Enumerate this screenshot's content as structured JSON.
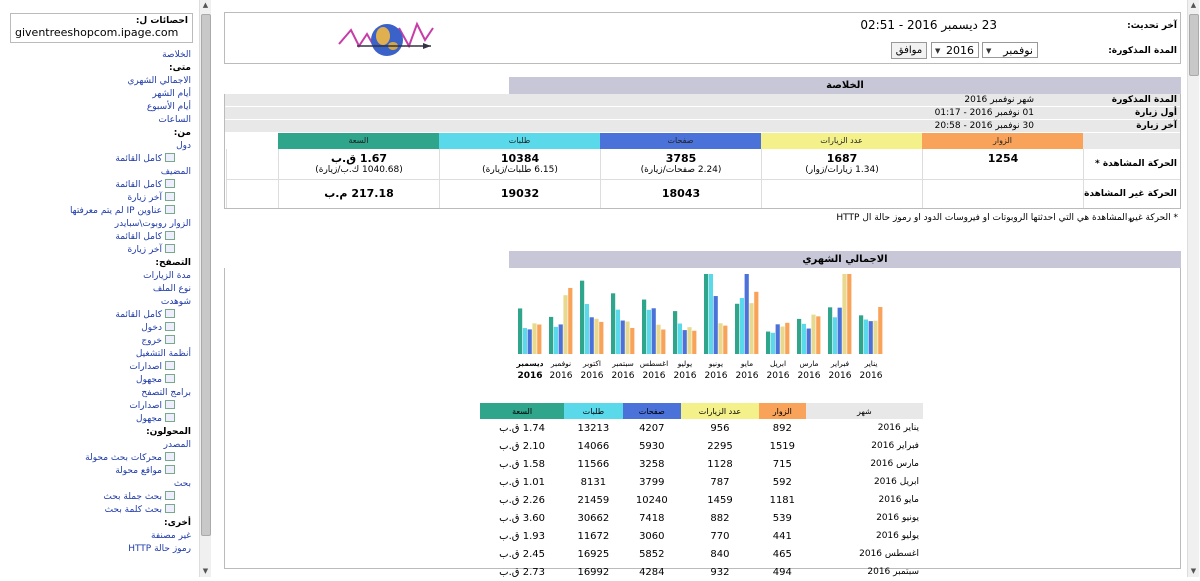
{
  "sidebar": {
    "stats_for_label": "احصائات ل:",
    "site": "giventreeshopcom.ipage.com",
    "rows": [
      {
        "t": "الخلاصة",
        "h": false,
        "ind": 0,
        "icon": false,
        "link": true
      },
      {
        "t": "متى:",
        "h": true,
        "ind": 0,
        "icon": false,
        "link": false
      },
      {
        "t": "الاجمالي الشهري",
        "h": false,
        "ind": 0,
        "icon": false,
        "link": true
      },
      {
        "t": "أيام الشهر",
        "h": false,
        "ind": 0,
        "icon": false,
        "link": true
      },
      {
        "t": "أيام الأسبوع",
        "h": false,
        "ind": 0,
        "icon": false,
        "link": true
      },
      {
        "t": "الساعات",
        "h": false,
        "ind": 0,
        "icon": false,
        "link": true
      },
      {
        "t": "من:",
        "h": true,
        "ind": 0,
        "icon": false,
        "link": false
      },
      {
        "t": "دول",
        "h": false,
        "ind": 0,
        "icon": false,
        "link": true
      },
      {
        "t": "كامل القائمة",
        "h": false,
        "ind": 2,
        "icon": true,
        "link": true
      },
      {
        "t": "المضيف",
        "h": false,
        "ind": 0,
        "icon": false,
        "link": true
      },
      {
        "t": "كامل القائمة",
        "h": false,
        "ind": 2,
        "icon": true,
        "link": true
      },
      {
        "t": "آخر زيارة",
        "h": false,
        "ind": 2,
        "icon": true,
        "link": true
      },
      {
        "t": "عناوين IP لم يتم معرفتها",
        "h": false,
        "ind": 2,
        "icon": true,
        "link": true
      },
      {
        "t": "الزوار روبوت\\سبايدر",
        "h": false,
        "ind": 0,
        "icon": false,
        "link": true
      },
      {
        "t": "كامل القائمة",
        "h": false,
        "ind": 2,
        "icon": true,
        "link": true
      },
      {
        "t": "آخر زيارة",
        "h": false,
        "ind": 2,
        "icon": true,
        "link": true
      },
      {
        "t": "التصفح:",
        "h": true,
        "ind": 0,
        "icon": false,
        "link": false
      },
      {
        "t": "مدة الزيارات",
        "h": false,
        "ind": 0,
        "icon": false,
        "link": true
      },
      {
        "t": "نوع الملف",
        "h": false,
        "ind": 0,
        "icon": false,
        "link": true
      },
      {
        "t": "شوهدت",
        "h": false,
        "ind": 0,
        "icon": false,
        "link": true
      },
      {
        "t": "كامل القائمة",
        "h": false,
        "ind": 2,
        "icon": true,
        "link": true
      },
      {
        "t": "دخول",
        "h": false,
        "ind": 2,
        "icon": true,
        "link": true
      },
      {
        "t": "خروج",
        "h": false,
        "ind": 2,
        "icon": true,
        "link": true
      },
      {
        "t": "أنظمة التشغيل",
        "h": false,
        "ind": 0,
        "icon": false,
        "link": true
      },
      {
        "t": "اصدارات",
        "h": false,
        "ind": 2,
        "icon": true,
        "link": true
      },
      {
        "t": "مجهول",
        "h": false,
        "ind": 2,
        "icon": true,
        "link": true
      },
      {
        "t": "برامج التصفح",
        "h": false,
        "ind": 0,
        "icon": false,
        "link": true
      },
      {
        "t": "اصدارات",
        "h": false,
        "ind": 2,
        "icon": true,
        "link": true
      },
      {
        "t": "مجهول",
        "h": false,
        "ind": 2,
        "icon": true,
        "link": true
      },
      {
        "t": "المحولون:",
        "h": true,
        "ind": 0,
        "icon": false,
        "link": false
      },
      {
        "t": "المصدر",
        "h": false,
        "ind": 0,
        "icon": false,
        "link": true
      },
      {
        "t": "محركات بحث محولة",
        "h": false,
        "ind": 2,
        "icon": true,
        "link": true
      },
      {
        "t": "مواقع محولة",
        "h": false,
        "ind": 2,
        "icon": true,
        "link": true
      },
      {
        "t": "بحث",
        "h": false,
        "ind": 0,
        "icon": false,
        "link": true
      },
      {
        "t": "بحث جملة بحث",
        "h": false,
        "ind": 2,
        "icon": true,
        "link": true
      },
      {
        "t": "بحث كلمة بحث",
        "h": false,
        "ind": 2,
        "icon": true,
        "link": true
      },
      {
        "t": "أخرى:",
        "h": true,
        "ind": 0,
        "icon": false,
        "link": false
      },
      {
        "t": "غير مصنفة",
        "h": false,
        "ind": 0,
        "icon": false,
        "link": true
      },
      {
        "t": "رموز حالة HTTP",
        "h": false,
        "ind": 0,
        "icon": false,
        "link": true
      }
    ]
  },
  "top": {
    "last_update_label": "آخر تحديث:",
    "last_update_value": "23 ديسمبر 2016 - 02:51",
    "period_label": "المدة المذكورة:",
    "month_value": "نوفمبر",
    "year_value": "2016",
    "ok_label": "موافق"
  },
  "summary": {
    "title": "الخلاصة",
    "period_label": "المدة المذكورة",
    "period_value": "شهر نوفمبر 2016",
    "first_visit_label": "أول زيارة",
    "first_visit_value": "01 نوفمبر 2016 - 01:17",
    "last_visit_label": "آخر زيارة",
    "last_visit_value": "30 نوفمبر 2016 - 20:58",
    "headers": [
      "الزوار",
      "عدد الزيارات",
      "صفحات",
      "طلبات",
      "السعة"
    ],
    "header_colors": [
      "#f9a35a",
      "#f4f08a",
      "#4a72d9",
      "#5ad9ea",
      "#2fa58c"
    ],
    "viewed_label": "الحركة المشاهدة *",
    "viewed": {
      "visitors": "1254",
      "visits": "1687",
      "visits_sub": "(1.34 زيارات/زوار)",
      "pages": "3785",
      "pages_sub": "(2.24 صفحات/زيارة)",
      "hits": "10384",
      "hits_sub": "(6.15 طلبات/زيارة)",
      "bandwidth": "1.67 ق.ب",
      "bandwidth_sub": "(1040.68 ك.ب/زيارة)"
    },
    "not_viewed_label": "الحركة غير المشاهدة *",
    "not_viewed": {
      "pages": "18043",
      "hits": "19032",
      "bandwidth": "217.18 م.ب"
    },
    "footnote": "* الحركة غير المشاهدة هي التي احدثتها الروبوتات او فيروسات الدود او رموز حالة ال HTTP"
  },
  "monthly": {
    "title": "الاجمالي الشهري",
    "table_headers": [
      "شهر",
      "الزوار",
      "عدد الزيارات",
      "صفحات",
      "طلبات",
      "السعة"
    ],
    "rows": [
      [
        "يناير 2016",
        "892",
        "956",
        "4207",
        "13213",
        "1.74 ق.ب"
      ],
      [
        "فبراير 2016",
        "1519",
        "2295",
        "5930",
        "14066",
        "2.10 ق.ب"
      ],
      [
        "مارس 2016",
        "715",
        "1128",
        "3258",
        "11566",
        "1.58 ق.ب"
      ],
      [
        "ابريل 2016",
        "592",
        "787",
        "3799",
        "8131",
        "1.01 ق.ب"
      ],
      [
        "مايو 2016",
        "1181",
        "1459",
        "10240",
        "21459",
        "2.26 ق.ب"
      ],
      [
        "يونيو 2016",
        "539",
        "882",
        "7418",
        "30662",
        "3.60 ق.ب"
      ],
      [
        "يوليو 2016",
        "441",
        "770",
        "3060",
        "11672",
        "1.93 ق.ب"
      ],
      [
        "اغسطس 2016",
        "465",
        "840",
        "5852",
        "16925",
        "2.45 ق.ب"
      ],
      [
        "سبتمبر 2016",
        "494",
        "932",
        "4284",
        "16992",
        "2.73 ق.ب"
      ]
    ]
  },
  "chart_data": {
    "type": "bar",
    "categories": [
      "يناير",
      "فبراير",
      "مارس",
      "ابريل",
      "مايو",
      "يونيو",
      "يوليو",
      "اغسطس",
      "سبتمبر",
      "اكتوبر",
      "نوفمبر",
      "ديسمبر"
    ],
    "year_label": "2016",
    "series": [
      {
        "name": "الزوار",
        "color": "#f9a35a",
        "values": [
          892,
          1519,
          715,
          592,
          1181,
          539,
          441,
          465,
          494,
          610,
          1254,
          560
        ]
      },
      {
        "name": "عدد الزيارات",
        "color": "#e8d990",
        "values": [
          956,
          2295,
          1128,
          787,
          1459,
          882,
          770,
          840,
          932,
          1010,
          1687,
          880
        ]
      },
      {
        "name": "صفحات",
        "color": "#4a72d9",
        "values": [
          4207,
          5930,
          3258,
          3799,
          10240,
          7418,
          3060,
          5852,
          4284,
          4700,
          3785,
          3150
        ]
      },
      {
        "name": "طلبات",
        "color": "#5ad9ea",
        "values": [
          13213,
          14066,
          11566,
          8131,
          21459,
          30662,
          11672,
          16925,
          16992,
          19150,
          10384,
          9950
        ]
      },
      {
        "name": "السعة",
        "color": "#2fa58c",
        "values": [
          1.74,
          2.1,
          1.58,
          1.01,
          2.26,
          3.6,
          1.93,
          2.45,
          2.73,
          3.3,
          1.67,
          2.05
        ]
      }
    ]
  }
}
